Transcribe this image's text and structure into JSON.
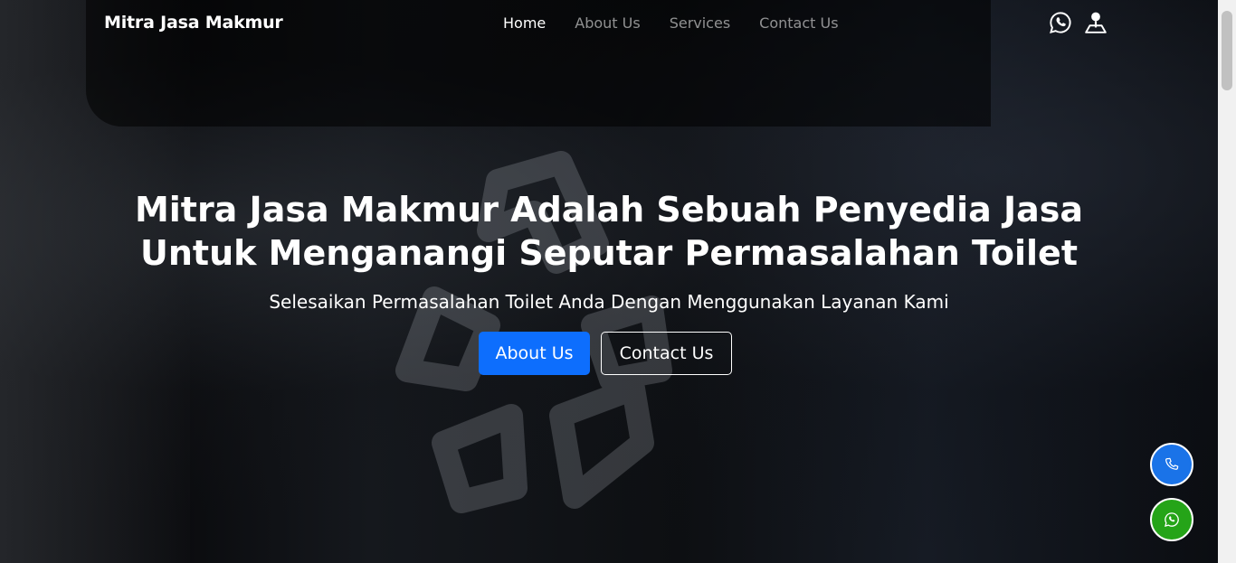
{
  "brand": {
    "name": "Mitra Jasa Makmur"
  },
  "nav": {
    "items": [
      {
        "label": "Home",
        "active": true
      },
      {
        "label": "About Us",
        "active": false
      },
      {
        "label": "Services",
        "active": false
      },
      {
        "label": "Contact Us",
        "active": false
      }
    ],
    "icons": [
      "whatsapp-icon",
      "map-pin-icon"
    ]
  },
  "hero": {
    "title_line1": "Mitra Jasa Makmur Adalah Sebuah Penyedia Jasa",
    "title_line2": "Untuk Menganangi Seputar Permasalahan Toilet",
    "subtitle": "Selesaikan Permasalahan Toilet Anda Dengan Menggunakan Layanan Kami",
    "primary_button": "About Us",
    "secondary_button": "Contact Us"
  },
  "floating": {
    "phone_icon": "phone-icon",
    "whatsapp_icon": "whatsapp-icon"
  },
  "colors": {
    "primary": "#0d6efd",
    "phone_button": "#1a73e8",
    "whatsapp_button": "#25a418",
    "text": "#ffffff"
  }
}
